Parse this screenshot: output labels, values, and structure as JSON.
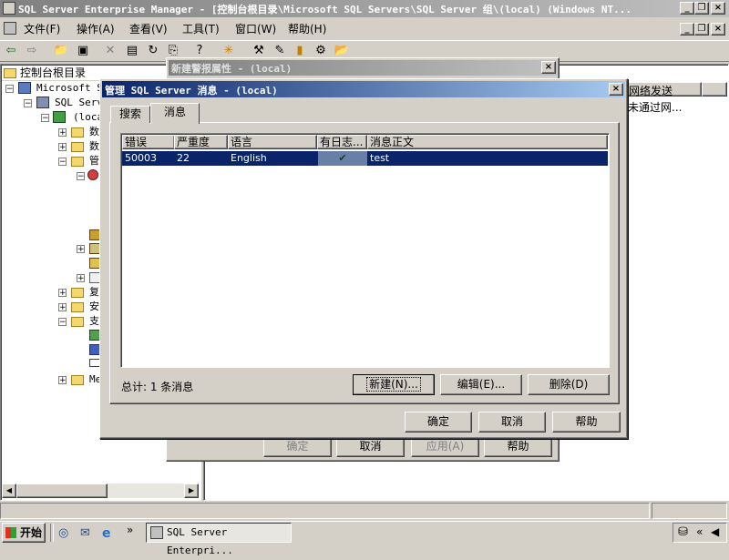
{
  "app": {
    "title": "SQL Server Enterprise Manager - [控制台根目录\\Microsoft SQL Servers\\SQL Server 组\\(local) (Windows NT..."
  },
  "menu": [
    "文件(F)",
    "操作(A)",
    "查看(V)",
    "工具(T)",
    "窗口(W)",
    "帮助(H)"
  ],
  "tree": {
    "root": "控制台根目录",
    "items": [
      "Microsoft SQ",
      "SQL Serv",
      "(local)",
      "数",
      "数",
      "管",
      "复",
      "安",
      "支",
      "Me"
    ]
  },
  "right_pane": {
    "col_header": "网络发送",
    "cell": "未通过网..."
  },
  "back_dialog": {
    "title": "新建警报属性 - (local)",
    "buttons": [
      "确定",
      "取消",
      "应用(A)",
      "帮助"
    ]
  },
  "dialog": {
    "title": "管理 SQL Server 消息 - (local)",
    "tabs": [
      "搜索",
      "消息"
    ],
    "columns": [
      "错误",
      "严重度",
      "语言",
      "有日志...",
      "消息正文"
    ],
    "rows": [
      {
        "error": "50003",
        "severity": "22",
        "language": "English",
        "logged": "✔",
        "text": "test"
      }
    ],
    "summary": "总计: 1 条消息",
    "list_buttons": [
      "新建(N)...",
      "编辑(E)...",
      "删除(D)"
    ],
    "buttons": [
      "确定",
      "取消",
      "帮助"
    ]
  },
  "taskbar": {
    "start": "开始",
    "task": "SQL Server Enterpri...",
    "chevron": "»"
  },
  "colors": {
    "title_active": "#0a246a",
    "selection": "#0a246a",
    "face": "#d4d0c8"
  }
}
